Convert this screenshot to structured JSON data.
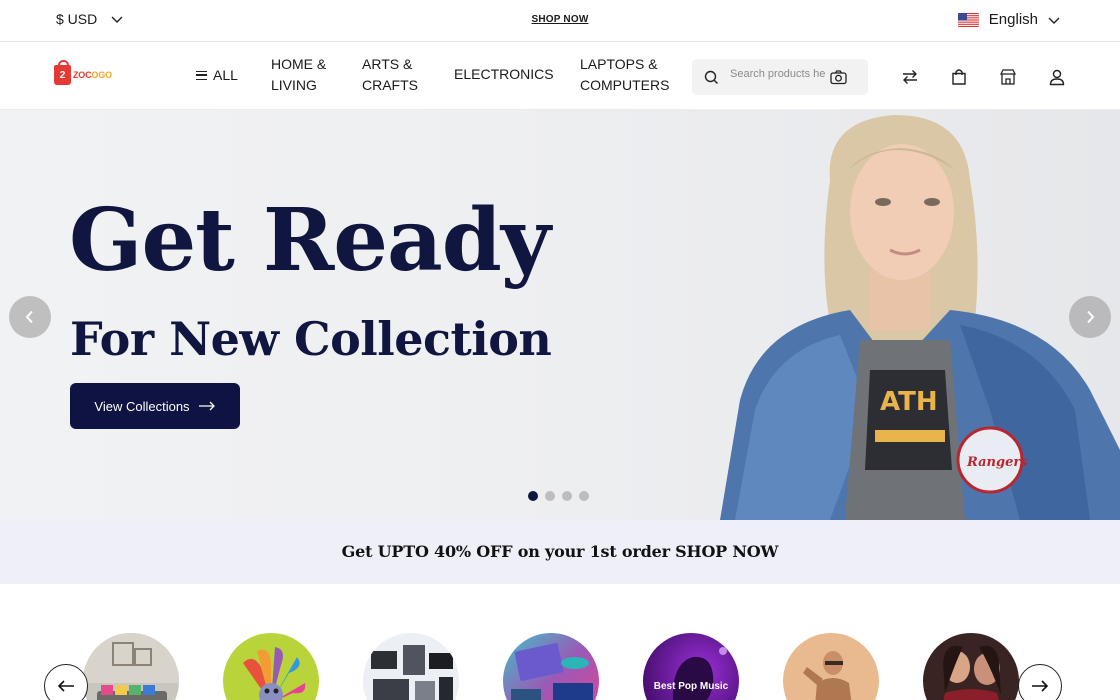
{
  "topbar": {
    "currency": "$ USD",
    "shop_now": "SHOP NOW",
    "language": "English"
  },
  "nav": {
    "logo_badge": "2",
    "logo_text_1": "ZOC",
    "logo_text_2": "OGO",
    "all_label": "ALL",
    "links": [
      {
        "line1": "HOME &",
        "line2": "LIVING"
      },
      {
        "line1": "ARTS &",
        "line2": "CRAFTS"
      },
      {
        "line1": "ELECTRONICS",
        "line2": ""
      },
      {
        "line1": "LAPTOPS &",
        "line2": "COMPUTERS"
      }
    ],
    "search_placeholder": "Search products here"
  },
  "hero": {
    "title": "Get Ready",
    "subtitle": "For New Collection",
    "button_label": "View Collections",
    "slide_count": 4,
    "active_slide": 1,
    "jacket_text": "Rangers"
  },
  "promo": {
    "text": "Get UPTO 40% OFF on your 1st order SHOP NOW"
  },
  "categories": [
    {
      "icon": "home-living-icon",
      "label": ""
    },
    {
      "icon": "arts-crafts-icon",
      "label": ""
    },
    {
      "icon": "electronics-icon",
      "label": ""
    },
    {
      "icon": "laptops-icon",
      "label": ""
    },
    {
      "icon": "music-icon",
      "label": "Best Pop Music"
    },
    {
      "icon": "mens-fashion-icon",
      "label": ""
    },
    {
      "icon": "womens-fashion-icon",
      "label": ""
    }
  ],
  "colors": {
    "navy": "#10163f",
    "brand_red": "#e53935",
    "promo_bg": "#eeeff9"
  }
}
